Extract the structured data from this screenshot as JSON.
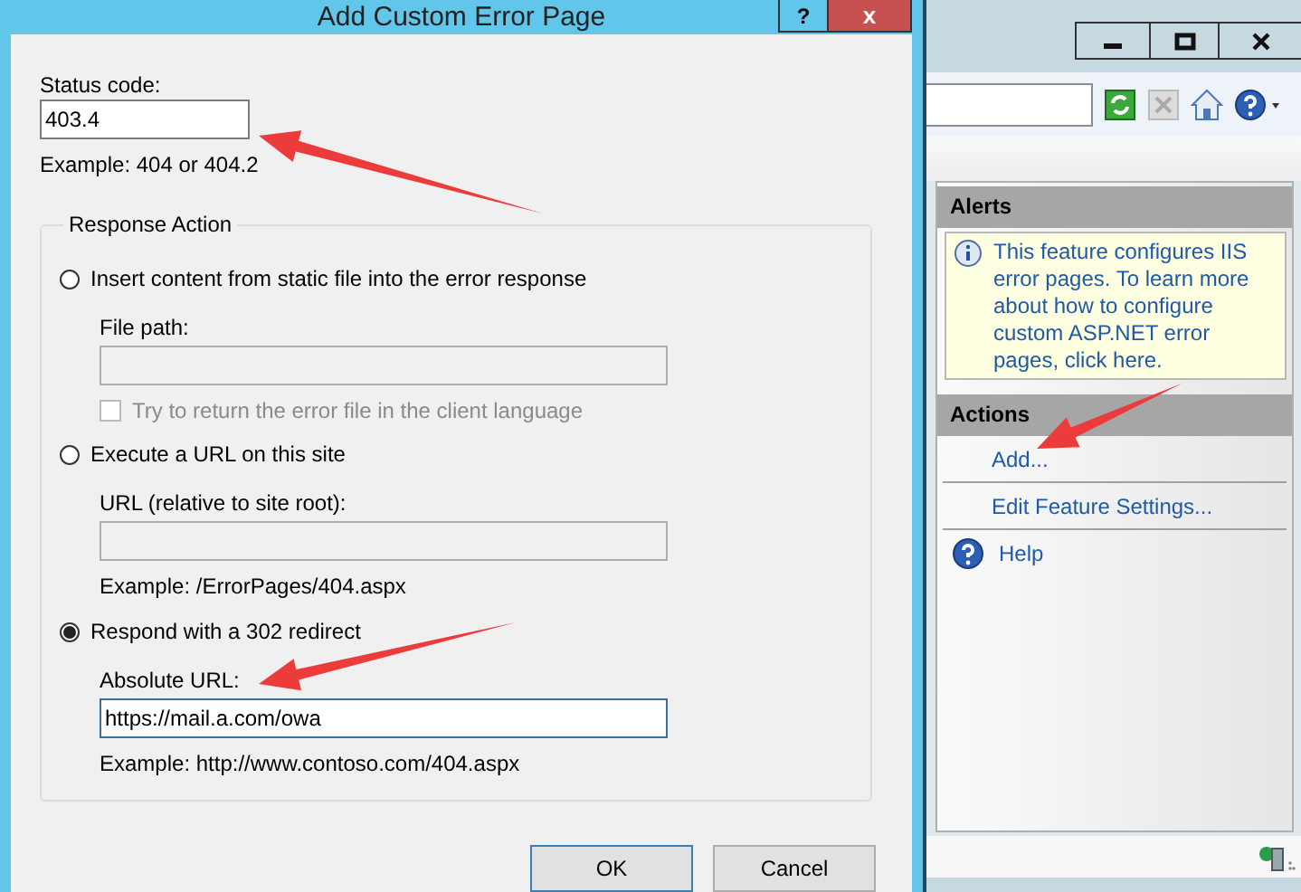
{
  "dialog": {
    "title": "Add Custom Error Page",
    "help_button": "?",
    "close_button": "x",
    "status_code": {
      "label": "Status code:",
      "value": "403.4",
      "example": "Example: 404 or 404.2"
    },
    "response_action": {
      "title": "Response Action",
      "options": [
        {
          "label": "Insert content from static file into the error response",
          "selected": false,
          "field": {
            "label": "File path:",
            "disabled": true
          },
          "checkbox": {
            "label": "Try to return the error file in the client language",
            "checked": false,
            "disabled": true
          }
        },
        {
          "label": "Execute a URL on this site",
          "selected": false,
          "field": {
            "label": "URL (relative to site root):",
            "disabled": true
          },
          "example": "Example: /ErrorPages/404.aspx"
        },
        {
          "label": "Respond with a 302 redirect",
          "selected": true,
          "field": {
            "label": "Absolute URL:",
            "value": "https://mail.a.com/owa",
            "disabled": false
          },
          "example": "Example: http://www.contoso.com/404.aspx"
        }
      ]
    },
    "buttons": [
      "OK",
      "Cancel"
    ]
  },
  "actions_pane": {
    "alerts": {
      "title": "Alerts",
      "message": "This feature configures IIS error pages. To learn more about how to configure custom ASP.NET error pages, click here."
    },
    "actions": {
      "title": "Actions",
      "items": [
        {
          "label": "Add...",
          "kind": "link"
        },
        {
          "label": "Edit Feature Settings...",
          "kind": "link"
        },
        {
          "label": "Help",
          "kind": "help"
        }
      ]
    }
  }
}
